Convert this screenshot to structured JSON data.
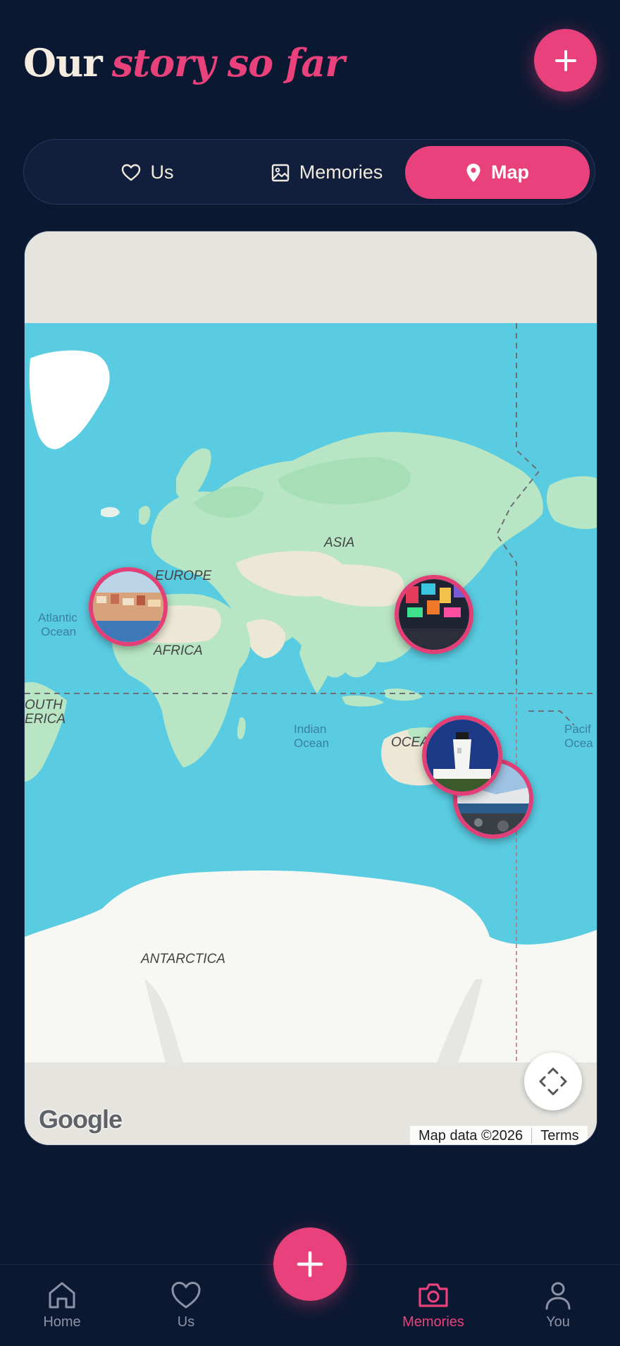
{
  "header": {
    "title_lead": "Our",
    "title_accent": "story so far",
    "add_icon": "plus-icon"
  },
  "tabs": [
    {
      "label": "Us",
      "icon": "heart-icon",
      "active": false
    },
    {
      "label": "Memories",
      "icon": "image-icon",
      "active": false
    },
    {
      "label": "Map",
      "icon": "map-pin-icon",
      "active": true
    }
  ],
  "map": {
    "labels": [
      "ASIA",
      "EUROPE",
      "AFRICA",
      "OCEA",
      "OUTH",
      "ERICA",
      "ANTARCTICA"
    ],
    "ocean_labels": [
      "Atlantic",
      "Ocean",
      "Indian",
      "Ocean",
      "Pacif",
      "Ocea"
    ],
    "logo": "Google",
    "attribution": "Map data ©2026",
    "terms": "Terms",
    "pins": [
      {
        "name": "memory-pin-lisbon",
        "subject": "Lisbon waterfront"
      },
      {
        "name": "memory-pin-tokyo",
        "subject": "Tokyo neon street"
      },
      {
        "name": "memory-pin-lighthouse",
        "subject": "Lighthouse"
      },
      {
        "name": "memory-pin-new-zealand",
        "subject": "Coastal landscape"
      }
    ]
  },
  "bottom_nav": [
    {
      "label": "Home",
      "icon": "home-icon",
      "active": false
    },
    {
      "label": "Us",
      "icon": "heart-icon",
      "active": false
    },
    {
      "label": "Memories",
      "icon": "camera-icon",
      "active": true
    },
    {
      "label": "You",
      "icon": "user-icon",
      "active": false
    }
  ],
  "colors": {
    "background": "#0b1831",
    "accent": "#e9417b",
    "ocean": "#5acce2",
    "land": "#b8e6c4"
  }
}
